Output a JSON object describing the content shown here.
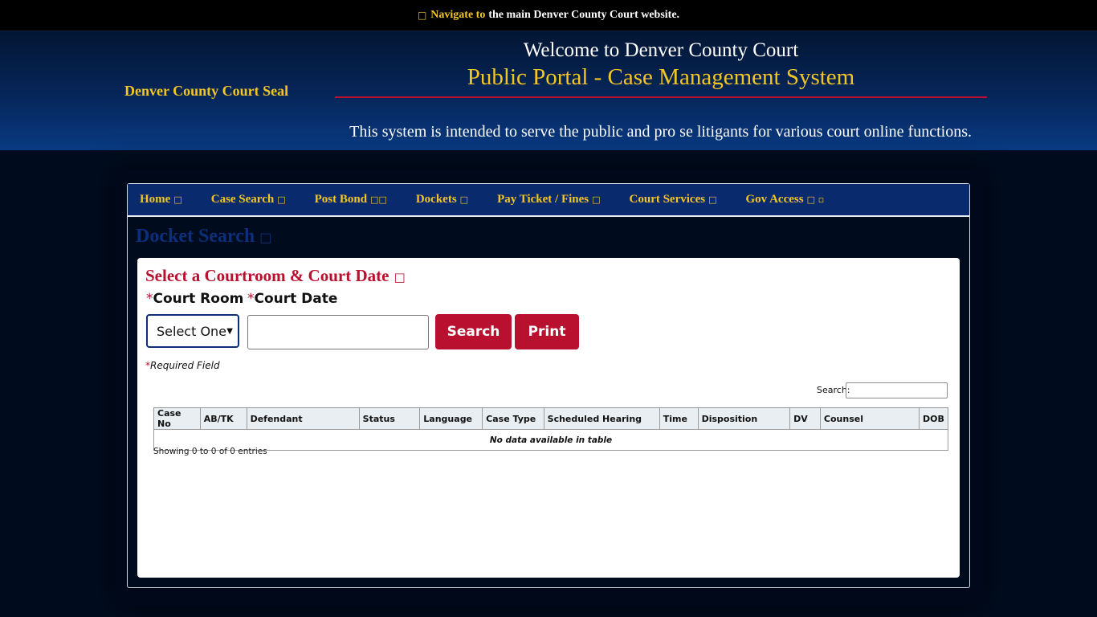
{
  "topbar": {
    "icon": "external-link-icon",
    "link_text": "Navigate to",
    "rest_text": "the main Denver County Court website."
  },
  "header": {
    "seal_alt": "Denver County Court Seal",
    "welcome": "Welcome to Denver County Court",
    "portal": "Public Portal - Case Management System",
    "tagline": "This system is intended to serve the public and pro se litigants for various court online functions."
  },
  "nav": {
    "items": [
      {
        "label": "Home",
        "glyph": "□"
      },
      {
        "label": "Case Search",
        "glyph": "□"
      },
      {
        "label": "Post Bond",
        "glyph": "□□"
      },
      {
        "label": "Dockets",
        "glyph": "□"
      },
      {
        "label": "Pay Ticket / Fines",
        "glyph": "□"
      },
      {
        "label": "Court Services",
        "glyph": "□"
      },
      {
        "label": "Gov Access",
        "glyph": "□ ▫"
      }
    ]
  },
  "page": {
    "title": "Docket Search",
    "title_glyph": "□"
  },
  "form": {
    "section_title": "Select a Courtroom & Court Date",
    "section_glyph": "□",
    "required_mark": "*",
    "court_room_label": "Court Room",
    "court_date_label": "Court Date",
    "court_room_value": "Select One",
    "court_date_value": "",
    "search_button": "Search",
    "print_button": "Print",
    "required_note": "Required Field"
  },
  "table": {
    "search_label": "Search:",
    "search_value": "",
    "columns": [
      "Case No",
      "AB/TK",
      "Defendant",
      "Status",
      "Language",
      "Case Type",
      "Scheduled Hearing",
      "Time",
      "Disposition",
      "DV",
      "Counsel",
      "DOB"
    ],
    "empty_message": "No data available in table",
    "info": "Showing 0 to 0 of 0 entries"
  },
  "colors": {
    "accent_gold": "#f3c623",
    "accent_red": "#b8102e",
    "nav_blue": "#0a2a6e"
  }
}
